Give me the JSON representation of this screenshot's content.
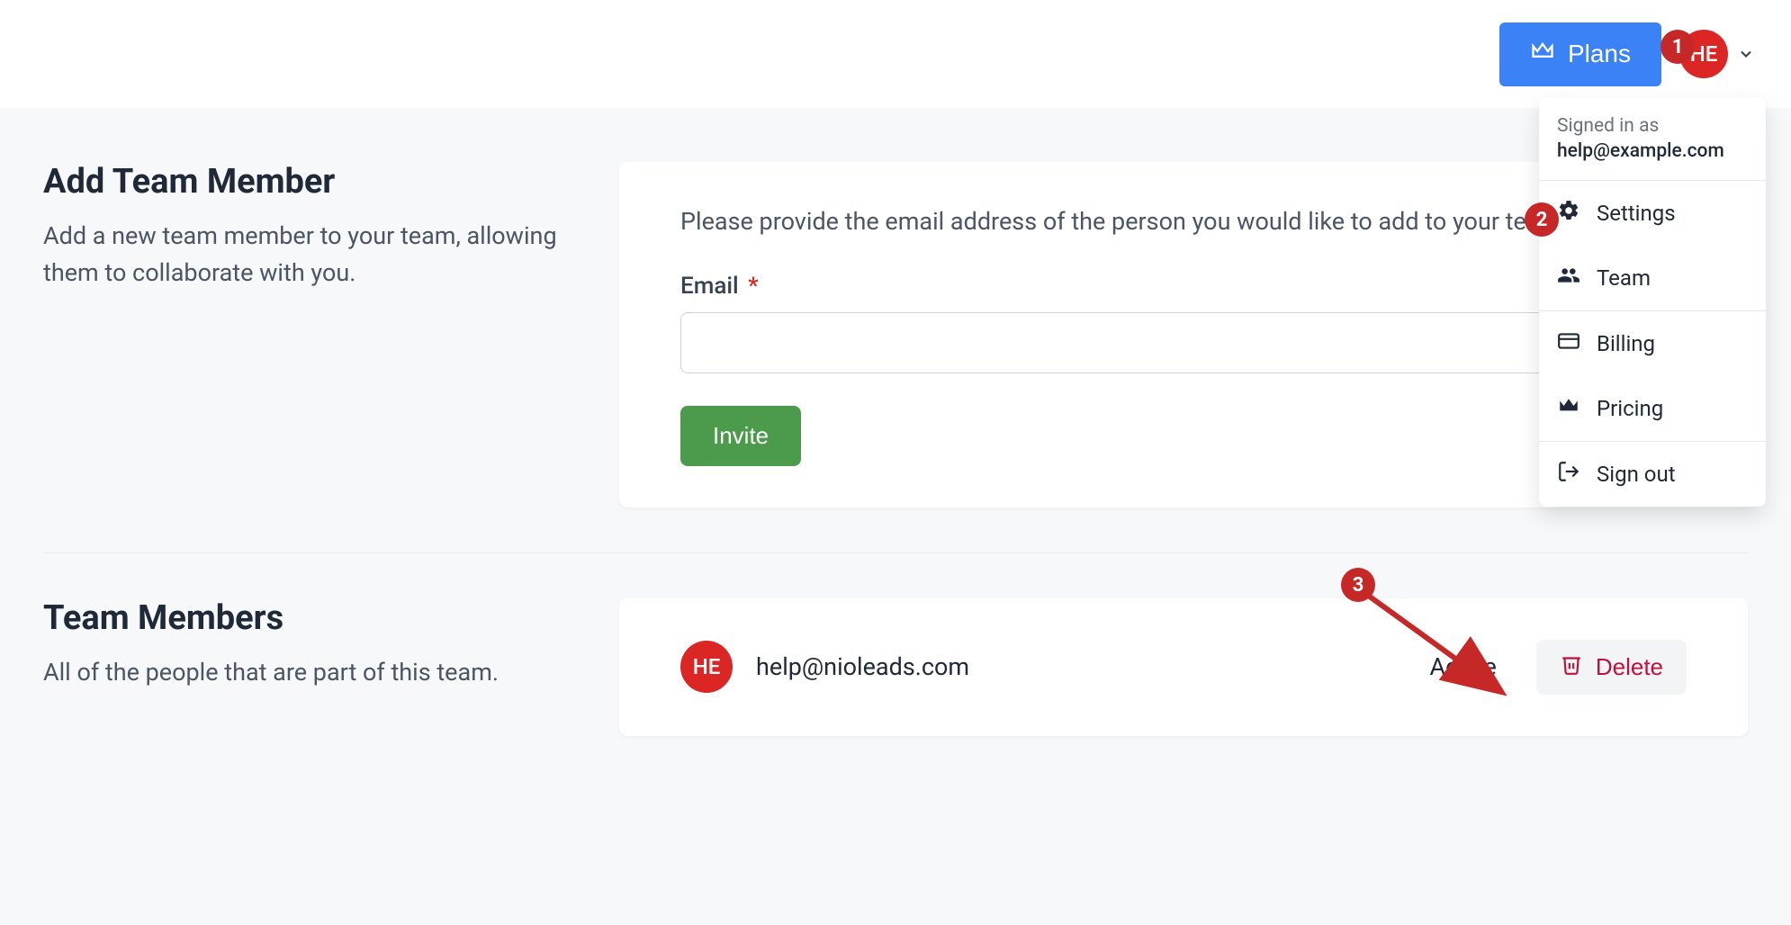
{
  "header": {
    "plans_label": "Plans",
    "avatar_initials": "HE"
  },
  "dropdown": {
    "signed_in_label": "Signed in as",
    "email": "help@example.com",
    "items": [
      {
        "icon": "gear-icon",
        "label": "Settings"
      },
      {
        "icon": "team-icon",
        "label": "Team"
      },
      {
        "icon": "card-icon",
        "label": "Billing"
      },
      {
        "icon": "crown-icon",
        "label": "Pricing"
      },
      {
        "icon": "signout-icon",
        "label": "Sign out"
      }
    ]
  },
  "add_member": {
    "title": "Add Team Member",
    "desc": "Add a new team member to your team, allowing them to collaborate with you.",
    "card_text": "Please provide the email address of the person you would like to add to your team.",
    "email_label": "Email",
    "required": "*",
    "email_value": "",
    "invite_label": "Invite"
  },
  "members": {
    "title": "Team Members",
    "desc": "All of the people that are part of this team.",
    "rows": [
      {
        "initials": "HE",
        "email": "help@nioleads.com",
        "status": "Active",
        "delete_label": "Delete"
      }
    ]
  },
  "annotations": {
    "a1": "1",
    "a2": "2",
    "a3": "3"
  },
  "colors": {
    "primary": "#3b82f6",
    "danger": "#dc2626",
    "success": "#4c9a4c",
    "delete_text": "#be123c"
  }
}
